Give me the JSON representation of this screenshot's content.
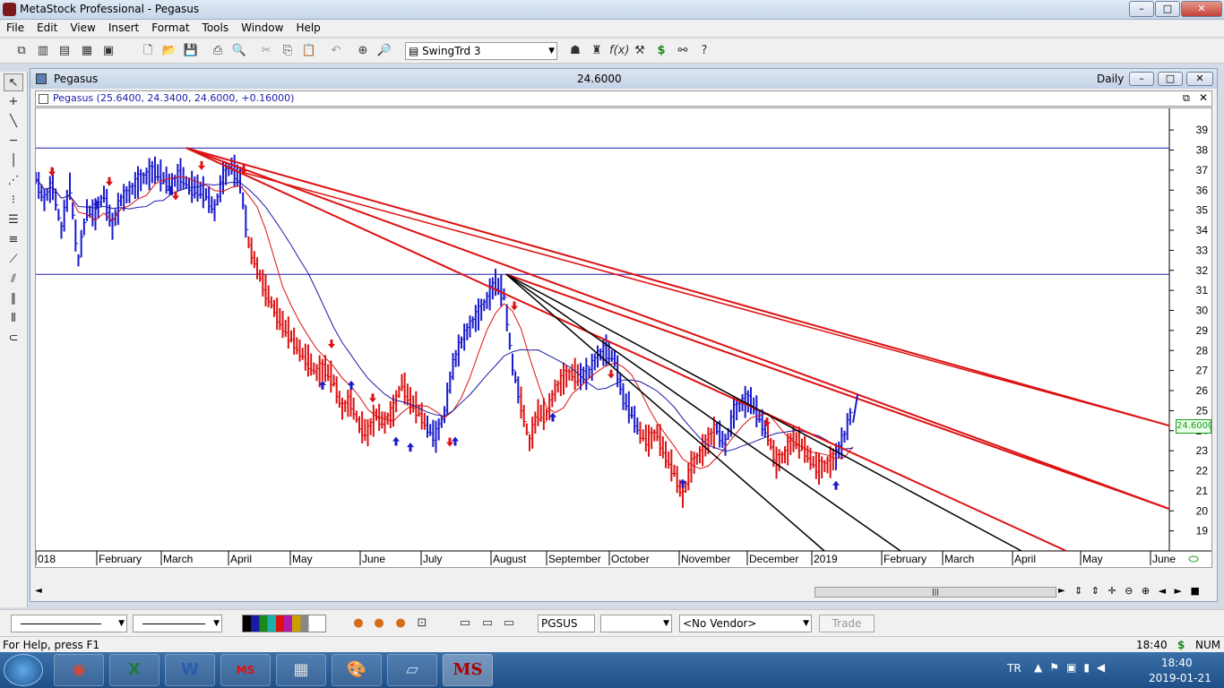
{
  "app": {
    "title": "MetaStock Professional - Pegasus",
    "window_controls": {
      "minimize": "–",
      "maximize": "□",
      "close": "✕"
    }
  },
  "menu": [
    "File",
    "Edit",
    "View",
    "Insert",
    "Format",
    "Tools",
    "Window",
    "Help"
  ],
  "toolbar": {
    "template_select": "SwingTrd 3",
    "template_icon": "swing-template-icon"
  },
  "chart_window": {
    "title": "Pegasus",
    "center_value": "24.6000",
    "periodicity": "Daily",
    "security_line": "Pegasus (25.6400, 24.3400, 24.6000, +0.16000)",
    "last_price_label": "24.6000"
  },
  "chart_data": {
    "type": "line",
    "title": "",
    "y_ticks": [
      19,
      20,
      21,
      22,
      23,
      24,
      25,
      26,
      27,
      28,
      29,
      30,
      31,
      32,
      33,
      34,
      35,
      36,
      37,
      38,
      39
    ],
    "ylim": [
      18,
      39.9
    ],
    "x_ticks": [
      "018",
      "February",
      "March",
      "April",
      "May",
      "June",
      "July",
      "August",
      "September",
      "October",
      "November",
      "December",
      "2019",
      "February",
      "March",
      "April",
      "May",
      "June"
    ],
    "price_path": [
      [
        0,
        36.6
      ],
      [
        5,
        35.5
      ],
      [
        10,
        36.3
      ],
      [
        15,
        34
      ],
      [
        20,
        36.2
      ],
      [
        25,
        32.5
      ],
      [
        30,
        35
      ],
      [
        35,
        34.8
      ],
      [
        40,
        35.8
      ],
      [
        45,
        34.2
      ],
      [
        50,
        35.5
      ],
      [
        55,
        35.9
      ],
      [
        60,
        36.4
      ],
      [
        65,
        36.7
      ],
      [
        70,
        37
      ],
      [
        75,
        36.6
      ],
      [
        80,
        36.3
      ],
      [
        85,
        36.8
      ],
      [
        90,
        36.2
      ],
      [
        95,
        36.1
      ],
      [
        100,
        35.8
      ],
      [
        105,
        35
      ],
      [
        110,
        36.6
      ],
      [
        115,
        37.2
      ],
      [
        120,
        36.5
      ],
      [
        125,
        33.4
      ],
      [
        130,
        32.1
      ],
      [
        135,
        31
      ],
      [
        140,
        30.1
      ],
      [
        145,
        29.3
      ],
      [
        150,
        28.7
      ],
      [
        155,
        28
      ],
      [
        160,
        27.5
      ],
      [
        165,
        26.9
      ],
      [
        170,
        27.1
      ],
      [
        175,
        26.5
      ],
      [
        180,
        25.1
      ],
      [
        185,
        25.5
      ],
      [
        190,
        24.3
      ],
      [
        195,
        23.9
      ],
      [
        200,
        24.8
      ],
      [
        205,
        24.4
      ],
      [
        210,
        25
      ],
      [
        215,
        26.4
      ],
      [
        220,
        25.5
      ],
      [
        225,
        25
      ],
      [
        230,
        24.2
      ],
      [
        235,
        23.7
      ],
      [
        240,
        24.8
      ],
      [
        245,
        27.2
      ],
      [
        250,
        28.4
      ],
      [
        255,
        29.2
      ],
      [
        260,
        29.8
      ],
      [
        265,
        30.5
      ],
      [
        270,
        31.4
      ],
      [
        275,
        30.8
      ],
      [
        280,
        27.3
      ],
      [
        285,
        25.4
      ],
      [
        290,
        23.4
      ],
      [
        295,
        24.9
      ],
      [
        300,
        24.8
      ],
      [
        305,
        26
      ],
      [
        310,
        26.6
      ],
      [
        315,
        26.9
      ],
      [
        320,
        26.7
      ],
      [
        325,
        26.9
      ],
      [
        330,
        27.7
      ],
      [
        335,
        28
      ],
      [
        340,
        27.6
      ],
      [
        345,
        25.7
      ],
      [
        350,
        24.9
      ],
      [
        355,
        23.9
      ],
      [
        360,
        23.5
      ],
      [
        365,
        23.9
      ],
      [
        370,
        22.8
      ],
      [
        375,
        22
      ],
      [
        380,
        20.7
      ],
      [
        385,
        22.2
      ],
      [
        390,
        22.8
      ],
      [
        395,
        23.5
      ],
      [
        400,
        24.1
      ],
      [
        405,
        23.3
      ],
      [
        410,
        24.9
      ],
      [
        415,
        25.4
      ],
      [
        420,
        25.5
      ],
      [
        425,
        24.7
      ],
      [
        430,
        23.8
      ],
      [
        435,
        22.4
      ],
      [
        440,
        22.8
      ],
      [
        445,
        23.6
      ],
      [
        450,
        23.3
      ],
      [
        455,
        22.6
      ],
      [
        460,
        22.1
      ],
      [
        465,
        22.3
      ],
      [
        470,
        22.7
      ],
      [
        475,
        23.7
      ],
      [
        480,
        25.2
      ]
    ],
    "series": [],
    "horizontal_lines": [
      38.1,
      31.8
    ],
    "last_close": 24.6
  },
  "tools_bottom": {
    "symbol": "PGSUS",
    "vendor": "<No Vendor>",
    "trade": "Trade"
  },
  "statusbar": {
    "help": "For Help, press F1",
    "time": "18:40",
    "dollar": "$",
    "num": "NUM"
  },
  "taskbar": {
    "lang": "TR",
    "time": "18:40",
    "date": "2019-01-21",
    "ms_label": "MS"
  }
}
